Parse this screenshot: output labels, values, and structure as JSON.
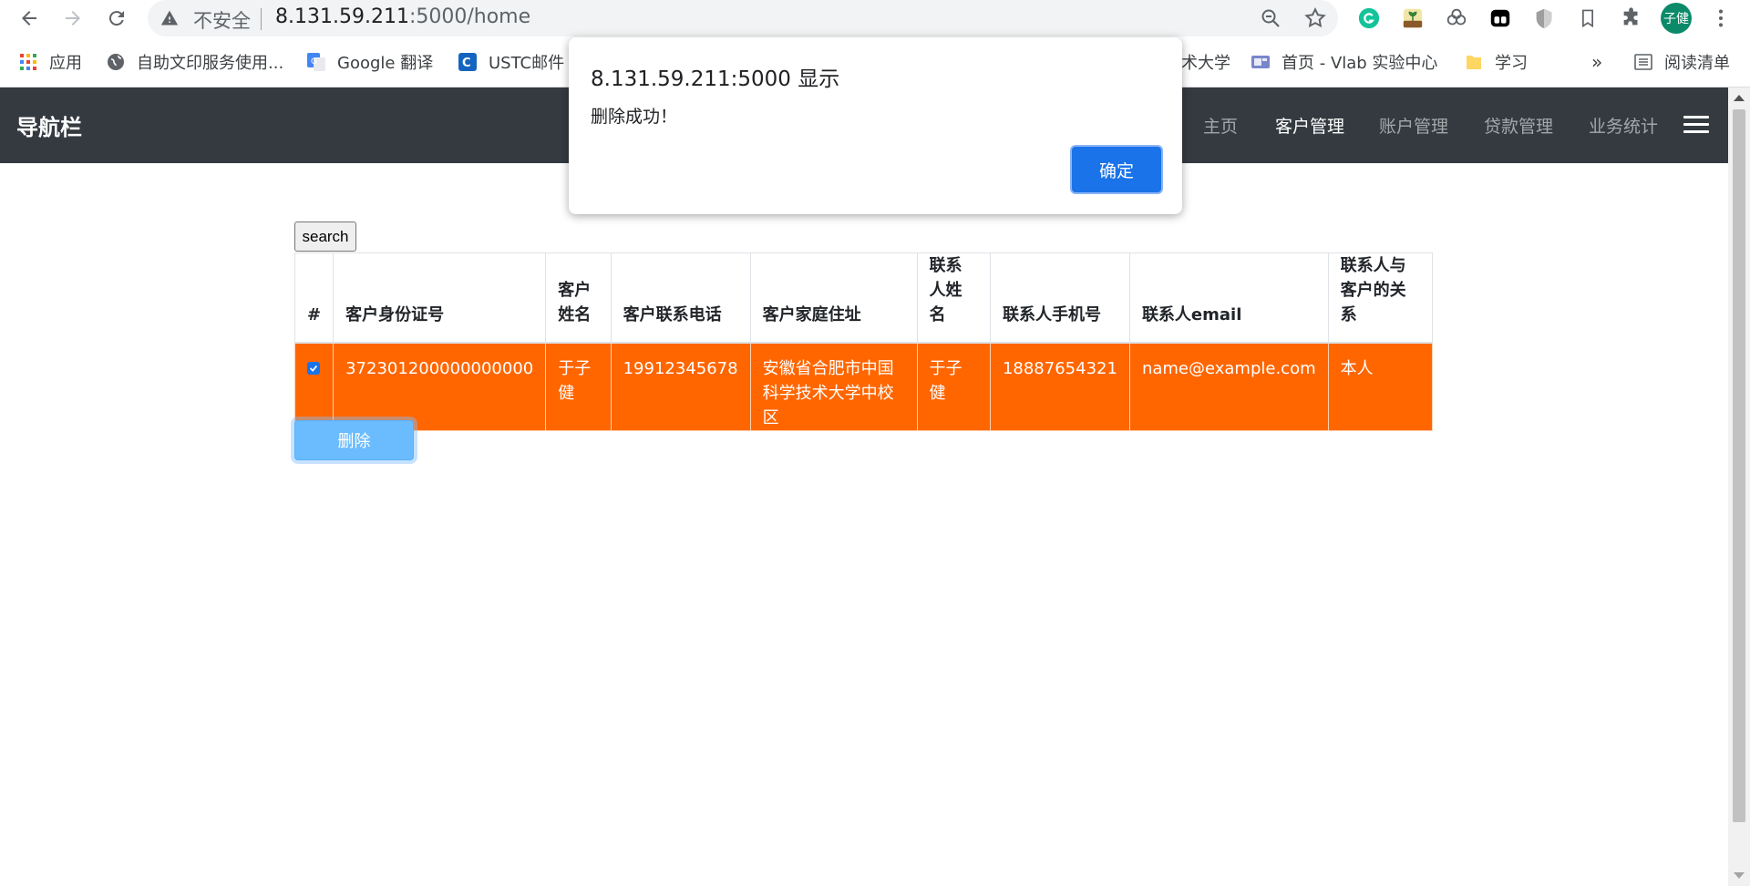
{
  "browser": {
    "insecure_label": "不安全",
    "url_host": "8.131.59.211",
    "url_rest": ":5000/home",
    "avatar_text": "子健",
    "bookmarks": [
      {
        "label": "应用",
        "icon": "apps-grid-icon"
      },
      {
        "label": "自助文印服务使用...",
        "icon": "globe-icon"
      },
      {
        "label": "Google 翻译",
        "icon": "google-translate-icon"
      },
      {
        "label": "USTC邮件",
        "icon": "ustc-mail-icon"
      },
      {
        "label": "术大学",
        "icon": "none"
      },
      {
        "label": "首页 - Vlab 实验中心",
        "icon": "vlab-icon"
      },
      {
        "label": "学习",
        "icon": "folder-icon"
      }
    ],
    "more_bookmarks": "»",
    "reading_list": "阅读清单"
  },
  "navbar": {
    "brand": "导航栏",
    "links": [
      {
        "label": "主页",
        "active": false
      },
      {
        "label": "客户管理",
        "active": true
      },
      {
        "label": "账户管理",
        "active": false
      },
      {
        "label": "贷款管理",
        "active": false
      },
      {
        "label": "业务统计",
        "active": false
      }
    ]
  },
  "search_button": "search",
  "table": {
    "headers": [
      "#",
      "客户身份证号",
      "客户姓名",
      "客户联系电话",
      "客户家庭住址",
      "联系人姓名",
      "联系人手机号",
      "联系人email",
      "联系人与客户的关系"
    ],
    "rows": [
      {
        "checked": true,
        "id": "372301200000000000",
        "name": "于子健",
        "phone": "19912345678",
        "address": "安徽省合肥市中国科学技术大学中校区",
        "contact_name": "于子健",
        "contact_phone": "18887654321",
        "contact_email": "name@example.com",
        "relation": "本人"
      }
    ]
  },
  "delete_button": "删除",
  "dialog": {
    "title": "8.131.59.211:5000 显示",
    "message": "删除成功！",
    "ok_label": "确定"
  },
  "colors": {
    "navbar_bg": "#343a40",
    "selected_row": "#ff6600",
    "primary_button": "#1a73e8",
    "delete_button": "#6bbcff"
  }
}
